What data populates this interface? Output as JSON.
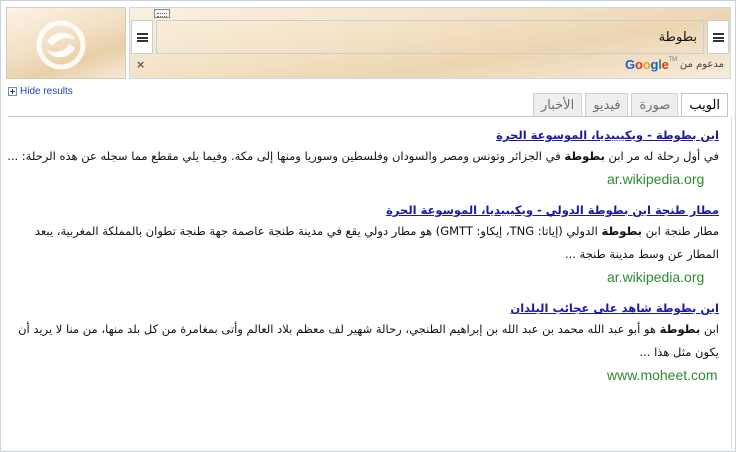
{
  "search": {
    "value": "بطوطة",
    "placeholder": ""
  },
  "powered_by": {
    "prefix": "مدعوم من",
    "logo_text": "Google",
    "logo_tm": "TM"
  },
  "clear_symbol": "×",
  "hide_results_label": "Hide results",
  "tabs": [
    {
      "label": "الويب",
      "active": true
    },
    {
      "label": "صورة",
      "active": false
    },
    {
      "label": "فيديو",
      "active": false
    },
    {
      "label": "الأخبار",
      "active": false
    }
  ],
  "results": [
    {
      "title": "ابن بطوطة - ويكيبيديا، الموسوعة الحرة",
      "snippet_before": "في أول رحلة له مر ابن ",
      "snippet_bold": "بطوطة",
      "snippet_after": " في الجزائر وتونس ومصر والسودان وفلسطين وسوريا ومنها إلى مكة. وفيما يلي مقطع مما سجله عن هذه الرحلة: ...",
      "url": "ar.wikipedia.org"
    },
    {
      "title": "مطار طنجة ابن بطوطة الدولي - ويكيبيديا، الموسوعة الحرة",
      "snippet_before": "مطار طنجة ابن ",
      "snippet_bold": "بطوطة",
      "snippet_after": " الدولي (إياتا: TNG، إيكاو: GMTT) هو مطار دولي يقع في مدينة طنجة عاصمة جهة طنجة تطوان بالمملكة المغربية، يبعد المطار عن وسط مدينة طنجة ...",
      "url": "ar.wikipedia.org"
    },
    {
      "title": "ابن بطوطة شاهد على عجائب البلدان",
      "snippet_before": "ابن ",
      "snippet_bold": "بطوطة",
      "snippet_after": " هو أبو عبد الله محمد بن عبد الله بن إبراهيم الطنجي، رحالة شهير لف معظم بلاد العالم وأتى بمغامرة من كل بلد منها، من منا لا يريد أن يكون مثل هذا ...",
      "url": "www.moheet.com"
    }
  ],
  "colors": {
    "link": "#1a1aa6",
    "url_green": "#2d8a2d",
    "google_blue": "#1a5fd0",
    "google_red": "#d8352a",
    "google_yellow": "#e8a90c",
    "google_green": "#2c9b3c"
  },
  "icons": [
    "text-direction-ltr-icon",
    "text-direction-rtl-icon",
    "clear-icon",
    "expand-plus-icon",
    "logo-mark-icon",
    "resize-grip-icon"
  ]
}
